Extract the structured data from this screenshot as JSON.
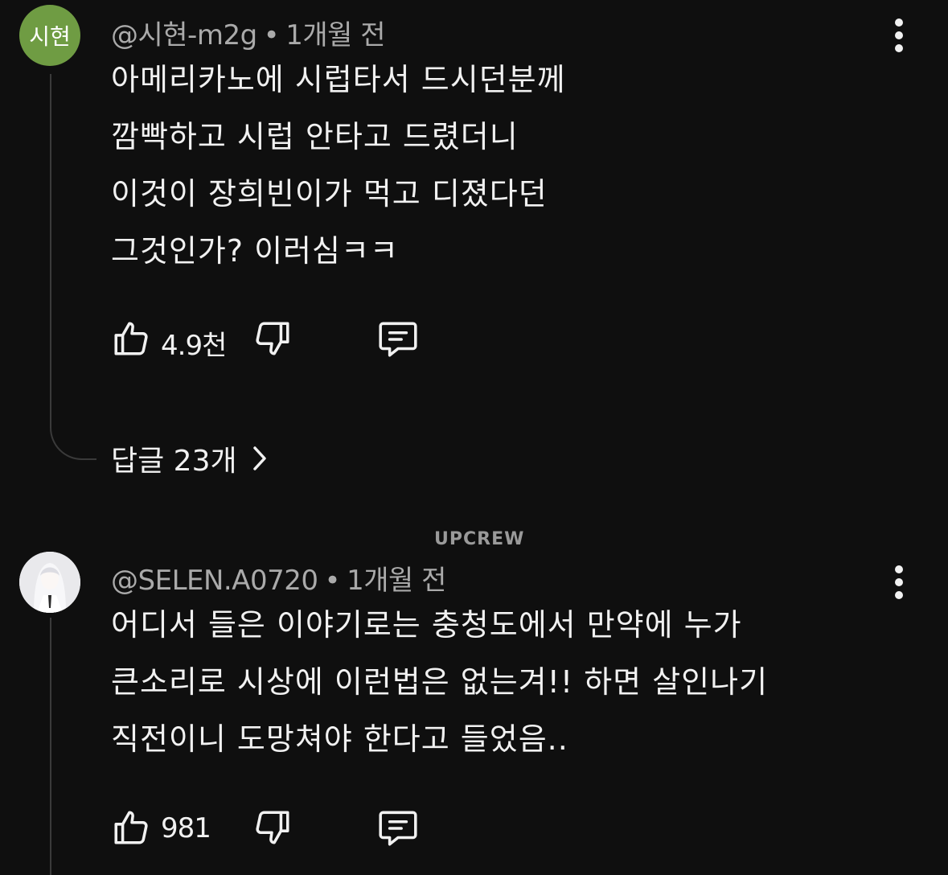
{
  "comments": [
    {
      "avatar_text": "시현",
      "author": "@시현-m2g",
      "separator": "•",
      "time": "1개월 전",
      "lines": [
        "아메리카노에 시럽타서 드시던분께",
        "깜빡하고 시럽 안타고 드렸더니",
        "이것이 장희빈이가 먹고 디졌다던",
        "그것인가? 이러심ㅋㅋ"
      ],
      "likes": "4.9천",
      "replies_label": "답글 23개"
    },
    {
      "avatar_text": "",
      "author": "@SELEN.A0720",
      "separator": "•",
      "time": "1개월 전",
      "lines": [
        "어디서 들은 이야기로는 충청도에서 만약에 누가",
        "큰소리로 시상에 이런법은 없는겨!! 하면 살인나기",
        "직전이니 도망쳐야 한다고 들었음.."
      ],
      "likes": "981"
    }
  ],
  "watermark": "UPCREW",
  "icons": {
    "like": "thumbs-up-icon",
    "dislike": "thumbs-down-icon",
    "reply": "comment-icon",
    "more": "more-vertical-icon",
    "chevron": "chevron-right-icon"
  },
  "colors": {
    "background": "#0f0f0f",
    "text": "#f1f1f1",
    "meta": "#aaaaaa",
    "avatar_green": "#6f9c43",
    "thread_line": "#3a3a3a"
  }
}
